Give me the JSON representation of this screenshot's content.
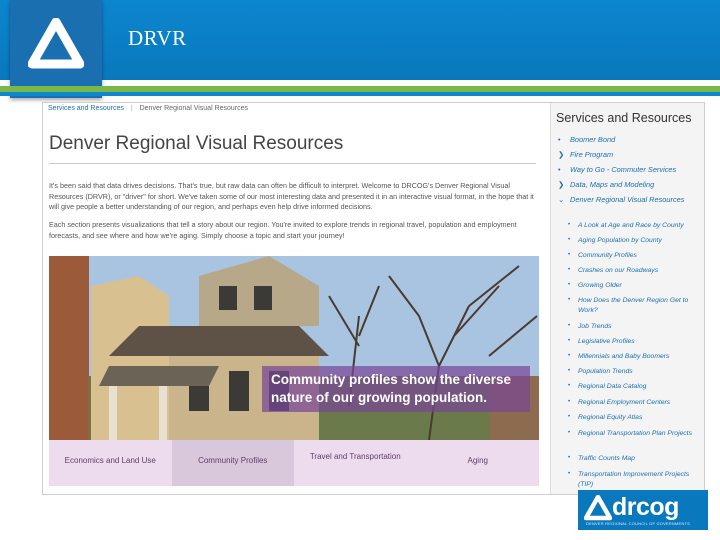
{
  "deck": {
    "title": "DRVR"
  },
  "page": {
    "breadcrumb": [
      "Services and Resources",
      "Denver Regional Visual Resources"
    ],
    "breadcrumb_sep": "|",
    "title": "Denver Regional Visual Resources",
    "intro_1": "It's been said that data drives decisions. That's true, but raw data can often be difficult to interpret. Welcome to DRCOG's Denver Regional Visual Resources (DRVR), or \"driver\" for short. We've taken some of our most interesting data and presented it in an interactive visual format, in the hope that it will give people a better understanding of our region, and perhaps even help drive informed decisions.",
    "intro_2": "Each section presents visualizations that tell a story about our region. You're invited to explore trends in regional travel, population and employment forecasts, and see where and how we're aging. Simply choose a topic and start your journey!",
    "hero_caption": "Community profiles show the diverse nature of our growing population.",
    "tabs": [
      "Economics and Land Use",
      "Community Profiles",
      "Travel and Transportation",
      "Aging"
    ],
    "active_tab": "Community Profiles"
  },
  "sidebar": {
    "title": "Services and Resources",
    "items": [
      {
        "label": "Boomer Bond",
        "marker": "•"
      },
      {
        "label": "Fire Program",
        "marker": "❯"
      },
      {
        "label": "Way to Go - Commuter Services",
        "marker": "•"
      },
      {
        "label": "Data, Maps and Modeling",
        "marker": "❯"
      },
      {
        "label": "Denver Regional Visual Resources",
        "marker": "⌄"
      }
    ],
    "subitems": [
      "A Look at Age and Race by County",
      "Aging Population by County",
      "Community Profiles",
      "Crashes on our Roadways",
      "Growing Older",
      "How Does the Denver Region Get to Work?",
      "Job Trends",
      "Legislative Profiles",
      "Millennials and Baby Boomers",
      "Population Trends",
      "Regional Data Catalog",
      "Regional Employment Centers",
      "Regional Equity Atlas",
      "Regional Transportation Plan Projects",
      "Traffic Counts Map",
      "Transportation Improvement Projects (TIP)"
    ]
  },
  "logo": {
    "wordmark": "drcog",
    "tagline": "DENVER REGIONAL COUNCIL OF GOVERNMENTS"
  },
  "colors": {
    "brand_blue": "#0a78bd",
    "accent_green": "#7ab648",
    "link_blue": "#1b6fb0",
    "caption_purple": "#784696"
  }
}
